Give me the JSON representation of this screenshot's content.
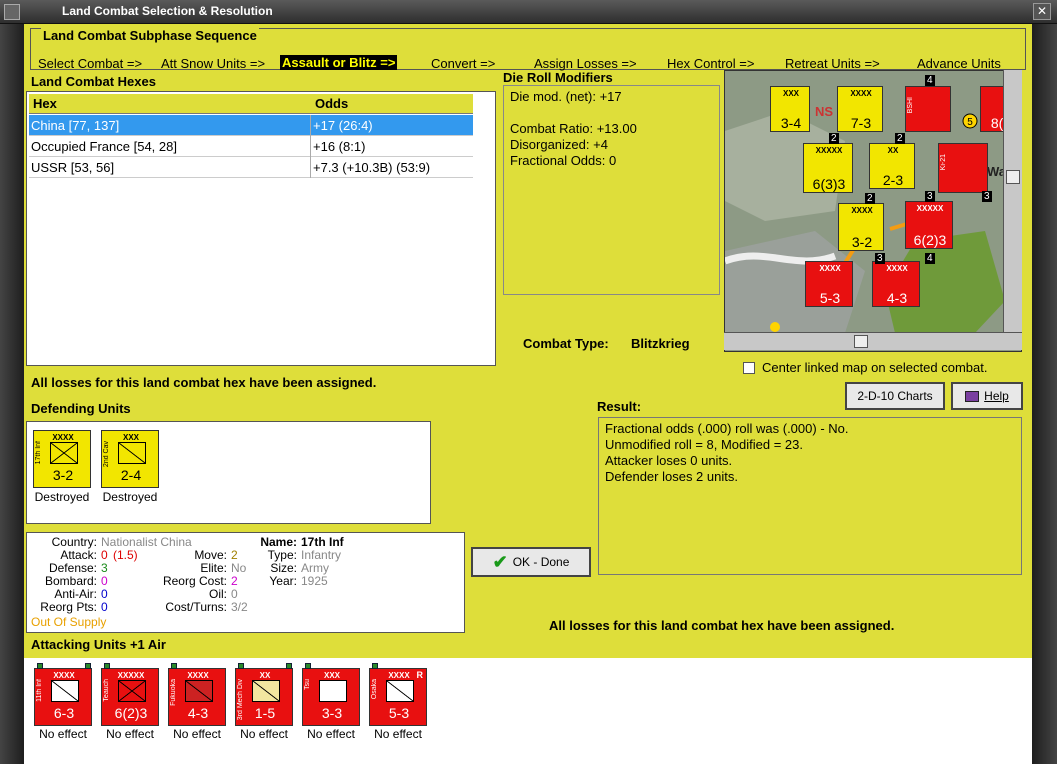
{
  "window": {
    "title": "Land Combat Selection & Resolution",
    "close_glyph": "✕"
  },
  "subphase": {
    "title": "Land Combat Subphase Sequence",
    "steps": [
      {
        "label": "Select Combat =>"
      },
      {
        "label": "Att Snow Units =>"
      },
      {
        "label": "Assault or Blitz =>"
      },
      {
        "label": "Convert =>"
      },
      {
        "label": "Assign Losses =>"
      },
      {
        "label": "Hex Control =>"
      },
      {
        "label": "Retreat Units =>"
      },
      {
        "label": "Advance Units"
      }
    ],
    "active_step": "Assault or Blitz =>"
  },
  "hexes": {
    "title": "Land Combat Hexes",
    "columns": [
      "Hex",
      "Odds"
    ],
    "rows": [
      {
        "hex": "China [77, 137]",
        "odds": "+17 (26:4)",
        "selected": true
      },
      {
        "hex": "Occupied France [54, 28]",
        "odds": "+16 (8:1)",
        "selected": false
      },
      {
        "hex": "USSR [53, 56]",
        "odds": "+7.3 (+10.3B) (53:9)",
        "selected": false
      }
    ]
  },
  "die_roll": {
    "title": "Die Roll Modifiers",
    "net": "Die mod. (net): +17",
    "ratio": "Combat Ratio: +13.00",
    "disorganized": "Disorganized: +4",
    "fractional": "Fractional Odds: 0"
  },
  "combat_type": {
    "label": "Combat Type:",
    "value": "Blitzkrieg"
  },
  "center_map_label": "Center linked map on selected combat.",
  "losses_msg_top": "All losses for this land combat hex have been assigned.",
  "losses_msg_bottom": "All losses for this land combat hex have been assigned.",
  "buttons": {
    "charts": "2-D-10 Charts",
    "help": "Help",
    "done": "OK - Done"
  },
  "result": {
    "title": "Result:",
    "lines": [
      "Fractional odds (.000) roll was (.000)  -  No.",
      "Unmodified roll = 8, Modified = 23.",
      "Attacker loses 0 units.",
      "Defender loses 2 units."
    ]
  },
  "defending": {
    "title": "Defending Units",
    "units": [
      {
        "name": "17th Inf",
        "size": "XXXX",
        "values": "3-2",
        "status": "Destroyed"
      },
      {
        "name": "2nd Cav",
        "size": "XXX",
        "values": "2-4",
        "status": "Destroyed"
      }
    ]
  },
  "unit_info": {
    "country_k": "Country:",
    "country_v": "Nationalist China",
    "attack_k": "Attack:",
    "attack_v": "0",
    "attack_paren": "(1.5)",
    "defense_k": "Defense:",
    "defense_v": "3",
    "bombard_k": "Bombard:",
    "bombard_v": "0",
    "antiair_k": "Anti-Air:",
    "antiair_v": "0",
    "reorgpts_k": "Reorg Pts:",
    "reorgpts_v": "0",
    "supply": "Out Of Supply",
    "move_k": "Move:",
    "move_v": "2",
    "elite_k": "Elite:",
    "elite_v": "No",
    "reorgcost_k": "Reorg Cost:",
    "reorgcost_v": "2",
    "oil_k": "Oil:",
    "oil_v": "0",
    "costturns_k": "Cost/Turns:",
    "costturns_v": "3/2",
    "name_k": "Name:",
    "name_v": "17th Inf",
    "type_k": "Type:",
    "type_v": "Infantry",
    "size_k": "Size:",
    "size_v": "Army",
    "year_k": "Year:",
    "year_v": "1925"
  },
  "attacking": {
    "title": "Attacking Units +1 Air",
    "units": [
      {
        "name": "11th Inf",
        "size": "XXXX",
        "values": "6-3",
        "status": "No effect",
        "tag": ""
      },
      {
        "name": "Teauch",
        "size": "XXXXX",
        "values": "6(2)3",
        "status": "No effect",
        "tag": ""
      },
      {
        "name": "Fukuoka",
        "size": "XXXX",
        "values": "4-3",
        "status": "No effect",
        "tag": ""
      },
      {
        "name": "3rd Mech Div",
        "size": "XX",
        "values": "1-5",
        "status": "No effect",
        "tag": ""
      },
      {
        "name": "Tsu",
        "size": "XXX",
        "values": "3-3",
        "status": "No effect",
        "tag": ""
      },
      {
        "name": "Osaka",
        "size": "XXXX",
        "values": "5-3",
        "status": "No effect",
        "tag": "R"
      }
    ]
  },
  "map": {
    "counters": [
      {
        "name": "Cav",
        "size": "XXX",
        "values": "3-4",
        "color": "yellow"
      },
      {
        "name": "Blitz Inf",
        "size": "XXXX",
        "values": "7-3",
        "color": "yellow"
      },
      {
        "name": "Mara",
        "size": "XXXXX",
        "values": "6(3)3",
        "color": "yellow"
      },
      {
        "name": "3rd Inf Div",
        "size": "XX",
        "values": "2-3",
        "color": "yellow"
      },
      {
        "name": "17th Inf",
        "size": "XXXX",
        "values": "3-2",
        "color": "yellow"
      },
      {
        "name": "",
        "size": "XXXXX",
        "values": "6(2)3",
        "color": "red"
      },
      {
        "name": "Osaka",
        "size": "XXXX",
        "values": "5-3",
        "color": "red"
      },
      {
        "name": "",
        "size": "XXXX",
        "values": "4-3",
        "color": "red"
      },
      {
        "name": "",
        "size": "",
        "values": "8(4",
        "color": "red"
      }
    ],
    "label_nsl": "NS",
    "label_wa": "Wa",
    "plane_labels": [
      "BSHI",
      "Ki-21"
    ],
    "stack_counts": [
      "2",
      "4",
      "2",
      "2",
      "3",
      "3",
      "3",
      "4"
    ],
    "air_values": [
      "5",
      "5"
    ]
  }
}
